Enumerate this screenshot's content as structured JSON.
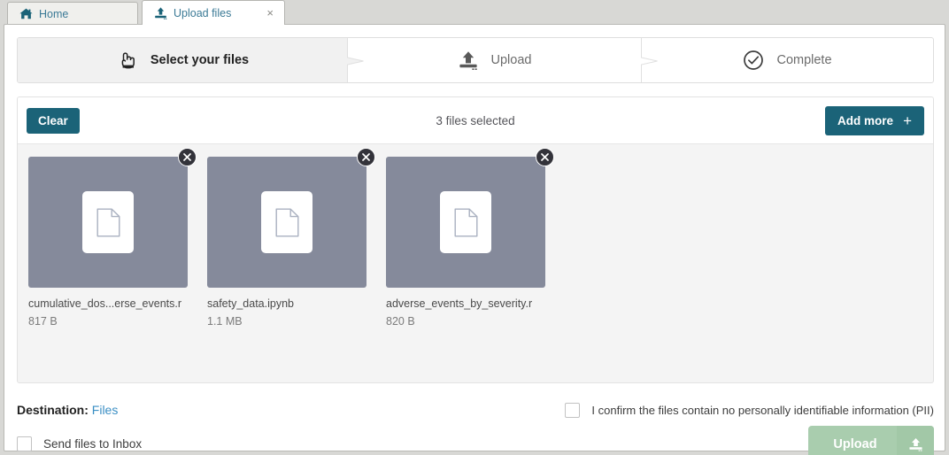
{
  "tabs": [
    {
      "label": "Home",
      "icon": "home-icon",
      "active": false,
      "closable": false
    },
    {
      "label": "Upload files",
      "icon": "upload-icon",
      "active": true,
      "closable": true,
      "close_glyph": "×"
    }
  ],
  "stepper": {
    "steps": [
      {
        "label": "Select your files",
        "icon": "pointing-hand-icon",
        "state": "active"
      },
      {
        "label": "Upload",
        "icon": "upload-tray-icon",
        "state": "pending"
      },
      {
        "label": "Complete",
        "icon": "check-circle-icon",
        "state": "pending"
      }
    ]
  },
  "toolbar": {
    "clear_label": "Clear",
    "count_label": "3 files selected",
    "add_more_label": "Add more",
    "add_more_glyph": "+"
  },
  "files": [
    {
      "name": "cumulative_dos...erse_events.r",
      "size": "817 B",
      "icon": "document-icon",
      "remove_glyph": "✕"
    },
    {
      "name": "safety_data.ipynb",
      "size": "1.1 MB",
      "icon": "document-icon",
      "remove_glyph": "✕"
    },
    {
      "name": "adverse_events_by_severity.r",
      "size": "820 B",
      "icon": "document-icon",
      "remove_glyph": "✕"
    }
  ],
  "footer": {
    "destination_label": "Destination:",
    "destination_value": "Files",
    "send_to_inbox_label": "Send files to Inbox",
    "send_to_inbox_checked": false,
    "pii_label": "I confirm the files contain no personally identifiable information (PII)",
    "pii_checked": false,
    "upload_label": "Upload",
    "upload_enabled": false
  },
  "colors": {
    "accent_teal": "#1b6378",
    "link_blue": "#3b8fc4",
    "tab_text": "#3b7a96",
    "thumb_bg": "#858a9b",
    "upload_disabled": "#a9cdae",
    "page_bg": "#d8d8d5"
  }
}
